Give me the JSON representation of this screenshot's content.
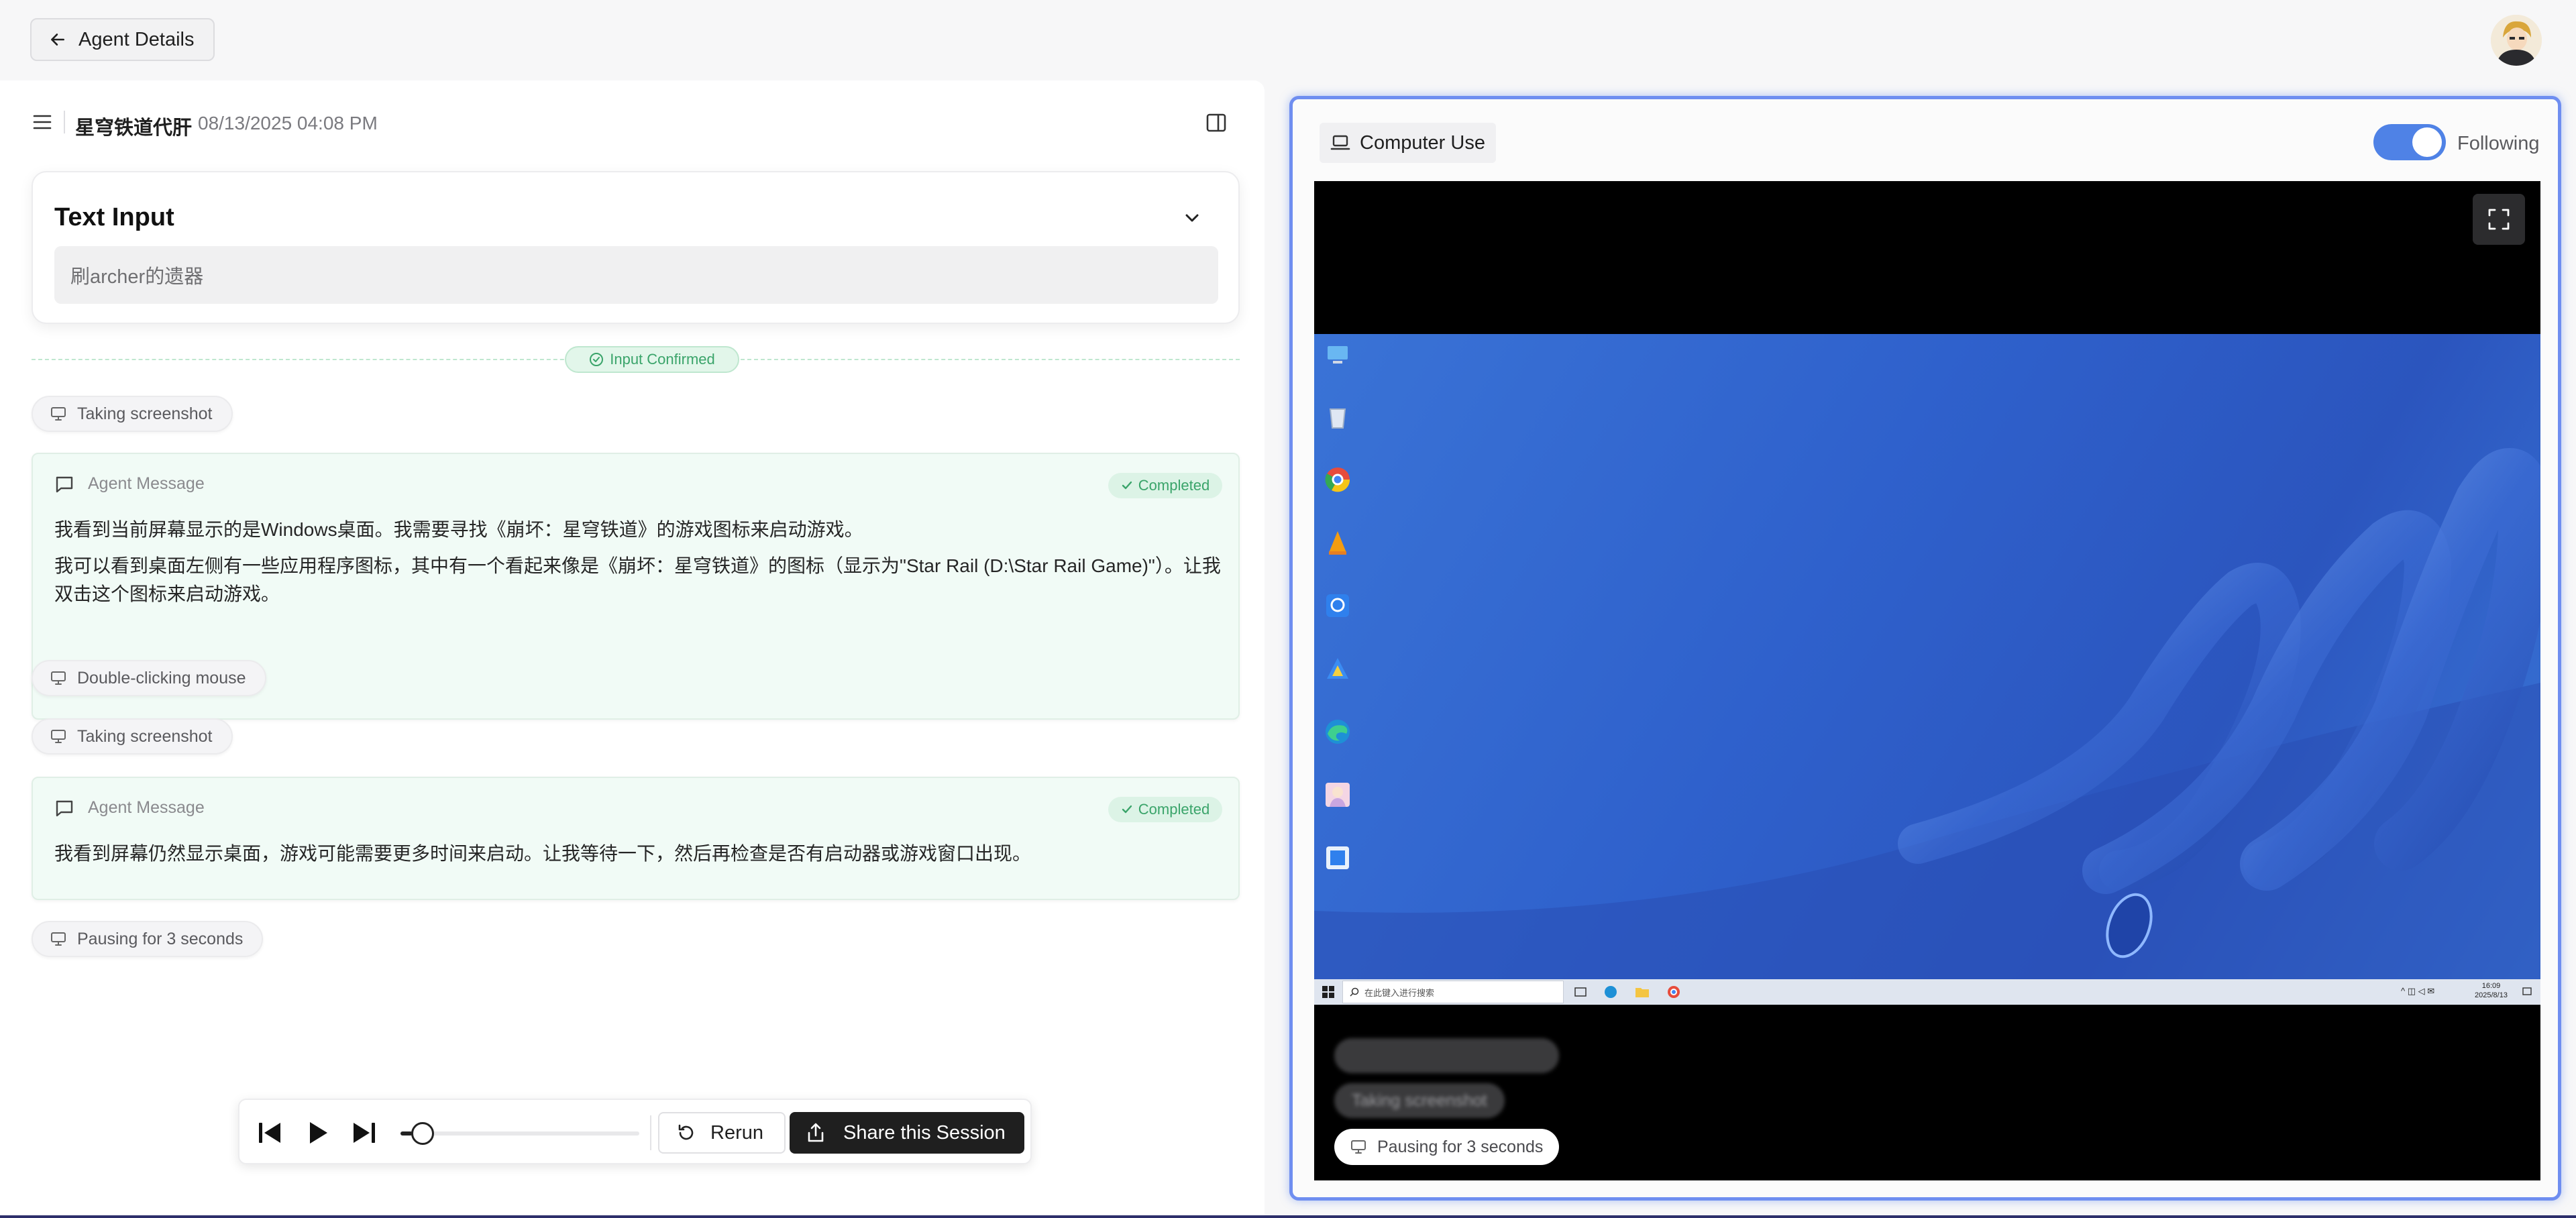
{
  "header": {
    "back_label": "Agent Details"
  },
  "session": {
    "title": "星穹铁道代肝",
    "timestamp": "08/13/2025 04:08 PM"
  },
  "text_input": {
    "title": "Text Input",
    "value": "刷archer的遗器",
    "confirmed_label": "Input Confirmed"
  },
  "steps": [
    {
      "label": "Taking screenshot"
    },
    {
      "label": "Double-clicking mouse"
    },
    {
      "label": "Taking screenshot"
    },
    {
      "label": "Pausing for 3 seconds"
    }
  ],
  "messages": [
    {
      "type": "Agent Message",
      "status": "Completed",
      "lines": [
        "我看到当前屏幕显示的是Windows桌面。我需要寻找《崩坏：星穹铁道》的游戏图标来启动游戏。",
        "我可以看到桌面左侧有一些应用程序图标，其中有一个看起来像是《崩坏：星穹铁道》的图标（显示为\"Star Rail (D:\\Star Rail Game)\"）。让我双击这个图标来启动游戏。"
      ]
    },
    {
      "type": "Agent Message",
      "status": "Completed",
      "lines": [
        "我看到屏幕仍然显示桌面，游戏可能需要更多时间来启动。让我等待一下，然后再检查是否有启动器或游戏窗口出现。"
      ]
    }
  ],
  "playback": {
    "progress": 0.05,
    "rerun_label": "Rerun",
    "share_label": "Share this Session"
  },
  "computer_use": {
    "label": "Computer Use",
    "following_label": "Following",
    "following_on": true,
    "overlay_steps": [
      "Taking screenshot",
      "Pausing for 3 seconds"
    ],
    "taskbar_search_placeholder": "在此键入进行搜索",
    "clock_time": "16:09",
    "clock_date": "2025/8/13"
  },
  "colors": {
    "accent": "#4f82e6",
    "success": "#3aa46a",
    "message_bg": "#f1fbf6"
  }
}
